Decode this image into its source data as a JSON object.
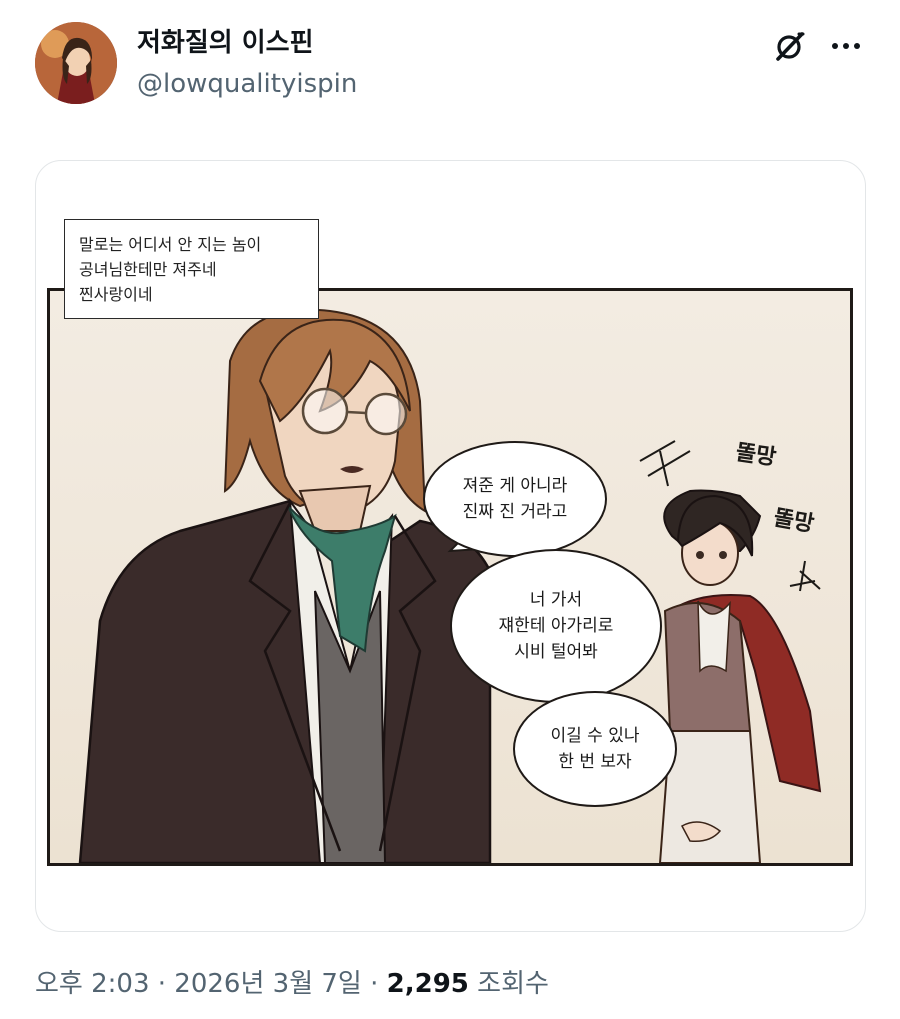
{
  "author": {
    "display_name": "저화질의 이스핀",
    "handle": "@lowqualityispin"
  },
  "icons": {
    "grok": "grok-icon",
    "more": "more-dots-icon",
    "avatar": "avatar-image"
  },
  "comic": {
    "caption_lines": [
      "말로는 어디서 안 지는 놈이",
      "공녀님한테만 져주네",
      "찐사랑이네"
    ],
    "bubble1": [
      "져준 게 아니라",
      "진짜 진 거라고"
    ],
    "bubble2": [
      "너 가서",
      "쟤한테 아가리로",
      "시비 털어봐"
    ],
    "bubble3": [
      "이길 수 있나",
      "한 번 보자"
    ],
    "sfx1": "똘망",
    "sfx2": "똘망"
  },
  "meta": {
    "time": "오후 2:03",
    "separator": "·",
    "date": "2026년 3월 7일",
    "views_count": "2,295",
    "views_label": "조회수"
  }
}
